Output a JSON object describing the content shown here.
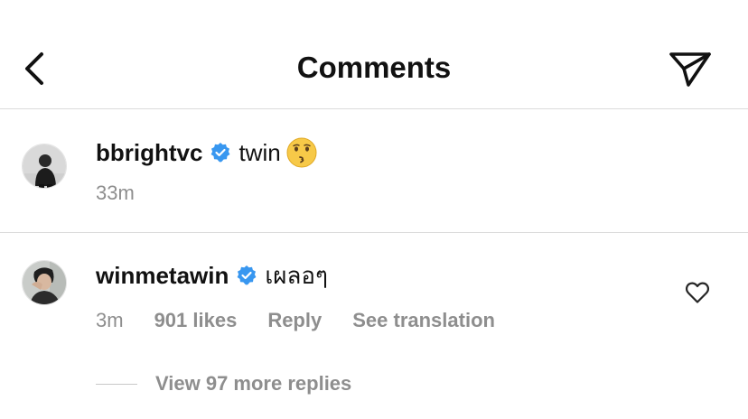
{
  "header": {
    "title": "Comments"
  },
  "comments": [
    {
      "username": "bbrightvc",
      "text": "twin",
      "time": "33m"
    },
    {
      "username": "winmetawin",
      "text": "เผลอๆ",
      "time": "3m",
      "likes": "901 likes",
      "reply_label": "Reply",
      "translate_label": "See translation",
      "view_replies": "View 97 more replies"
    }
  ],
  "colors": {
    "verified_blue": "#3897f0",
    "meta_gray": "#8e8e8e",
    "divider": "#dbdbdb"
  },
  "icons": {
    "back": "chevron-left-icon",
    "send": "paper-plane-icon",
    "verified": "verified-badge-icon",
    "emoji": "kissing-face-emoji",
    "like": "heart-outline-icon"
  }
}
